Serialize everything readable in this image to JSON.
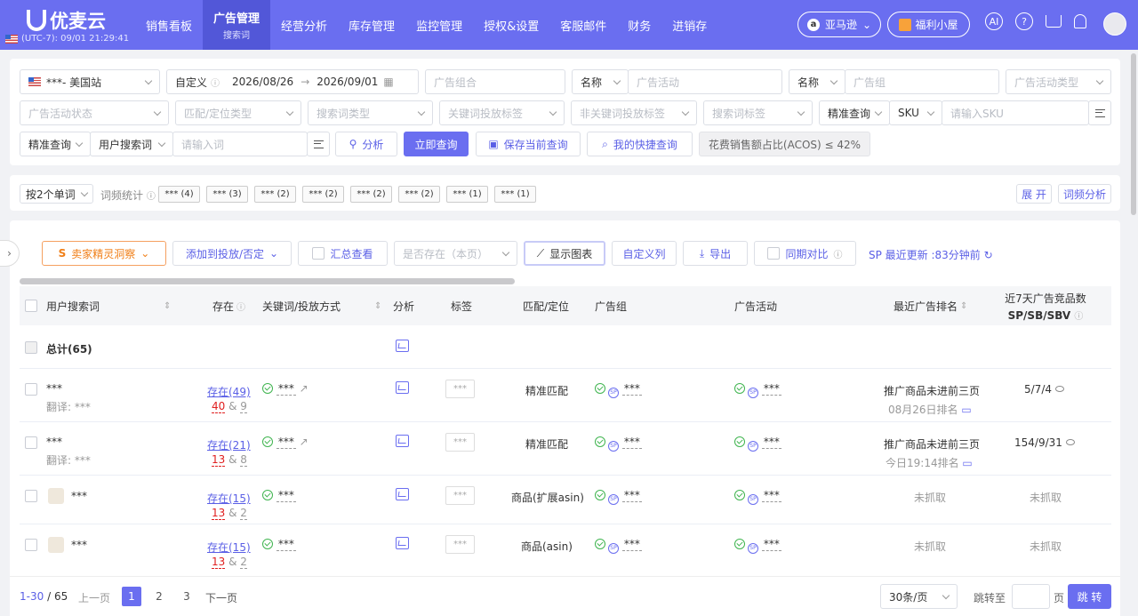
{
  "header": {
    "logo_text": "优麦云",
    "timezone": "(UTC-7): 09/01 21:29:41",
    "nav": [
      {
        "label": "销售看板"
      },
      {
        "label": "广告管理",
        "sub": "搜索词"
      },
      {
        "label": "经营分析"
      },
      {
        "label": "库存管理"
      },
      {
        "label": "监控管理"
      },
      {
        "label": "授权&设置"
      },
      {
        "label": "客服邮件"
      },
      {
        "label": "财务"
      },
      {
        "label": "进销存"
      }
    ],
    "marketplace": "亚马逊",
    "marketplace_icon": "a",
    "fuli": "福利小屋",
    "ai": "AI",
    "help": "?"
  },
  "filters": {
    "store": "***- 美国站",
    "date_mode": "自定义",
    "date_start": "2026/08/26",
    "date_arrow": "→",
    "date_end": "2026/09/01",
    "ad_portfolio_ph": "广告组合",
    "name1": "名称",
    "ad_campaign_ph": "广告活动",
    "name2": "名称",
    "ad_group_ph": "广告组",
    "campaign_type_ph": "广告活动类型",
    "campaign_status_ph": "广告活动状态",
    "match_type_ph": "匹配/定位类型",
    "search_term_type_ph": "搜索词类型",
    "keyword_tag_ph": "关键词投放标签",
    "nonkeyword_tag_ph": "非关键词投放标签",
    "search_term_tag_ph": "搜索词标签",
    "precise": "精准查询",
    "sku_label": "SKU",
    "sku_ph": "请输入SKU",
    "precise2": "精准查询",
    "user_term": "用户搜索词",
    "word_ph": "请输入词",
    "analyze": "分析",
    "query": "立即查询",
    "save_query": "保存当前查询",
    "quick_query": "我的快捷查询",
    "acos": "花费销售额占比(ACOS) ≤ 42%"
  },
  "wordfreq": {
    "mode": "按2个单词",
    "label": "词频统计",
    "tags": [
      "*** (4)",
      "*** (3)",
      "*** (2)",
      "*** (2)",
      "*** (2)",
      "*** (2)",
      "*** (1)",
      "*** (1)"
    ],
    "expand": "展 开",
    "analysis": "词频分析"
  },
  "toolbar": {
    "insight": "卖家精灵洞察",
    "add_to": "添加到投放/否定",
    "summary": "汇总查看",
    "exists_ph": "是否存在（本页）",
    "show_chart": "显示图表",
    "custom_cols": "自定义列",
    "export": "导出",
    "compare": "同期对比",
    "update": "SP 最近更新 :83分钟前"
  },
  "table": {
    "headers": [
      "用户搜索词",
      "存在",
      "关键词/投放方式",
      "分析",
      "标签",
      "匹配/定位",
      "广告组",
      "广告活动",
      "最近广告排名",
      "近7天广告竞品数",
      "SP/SB/SBV"
    ],
    "total": "总计(65)",
    "rows": [
      {
        "term": "***",
        "trans": "翻译: ***",
        "exists": "存在(49)",
        "n1": "40",
        "amp": "&",
        "n2": "9",
        "kw": "***",
        "tag": "***",
        "match": "精准匹配",
        "group": "***",
        "campaign": "***",
        "rank": "推广商品未进前三页",
        "rank_time": "08月26日排名",
        "comp": "5/7/4"
      },
      {
        "term": "***",
        "trans": "翻译: ***",
        "exists": "存在(21)",
        "n1": "13",
        "amp": "&",
        "n2": "8",
        "kw": "***",
        "tag": "***",
        "match": "精准匹配",
        "group": "***",
        "campaign": "***",
        "rank": "推广商品未进前三页",
        "rank_time": "今日19:14排名",
        "comp": "154/9/31"
      },
      {
        "term": "***",
        "exists": "存在(15)",
        "n1": "13",
        "amp": "&",
        "n2": "2",
        "kw": "***",
        "tag": "***",
        "match": "商品(扩展asin)",
        "group": "***",
        "campaign": "***",
        "rank": "未抓取",
        "comp": "未抓取"
      },
      {
        "term": "***",
        "exists": "存在(15)",
        "n1": "13",
        "amp": "&",
        "n2": "2",
        "kw": "***",
        "tag": "***",
        "match": "商品(asin)",
        "group": "***",
        "campaign": "***",
        "rank": "未抓取",
        "comp": "未抓取"
      }
    ]
  },
  "pagination": {
    "range": "1-30",
    "sep": "/",
    "total": "65",
    "prev": "上一页",
    "pages": [
      "1",
      "2",
      "3"
    ],
    "next": "下一页",
    "per_page": "30条/页",
    "jump": "跳转至",
    "page_unit": "页",
    "go": "跳 转"
  }
}
